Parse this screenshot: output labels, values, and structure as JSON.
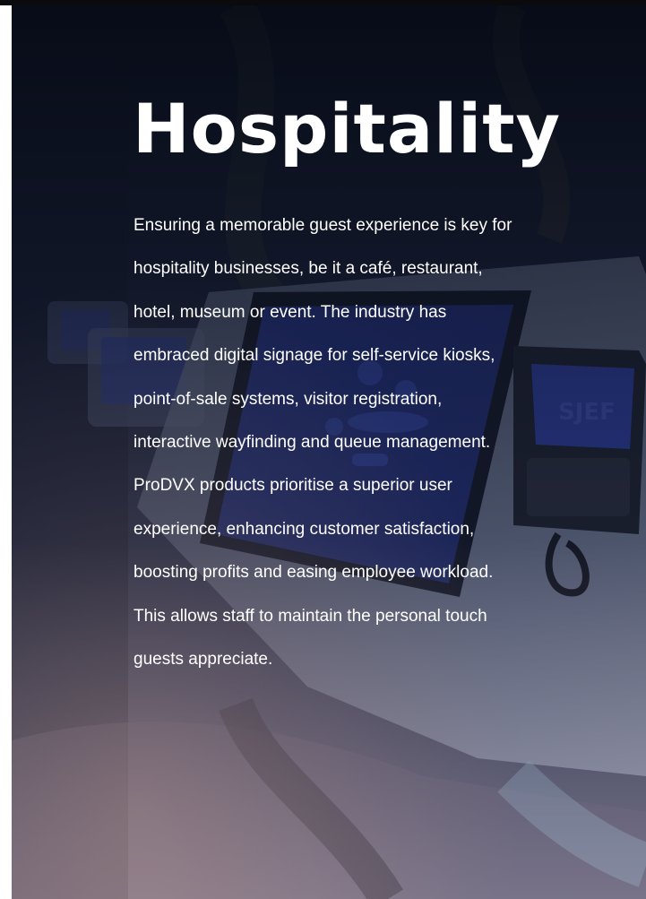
{
  "heading": "Hospitality",
  "body_lines": [
    "Ensuring a memorable guest experience is key for",
    "hospitality businesses, be it a café, restaurant,",
    "hotel, museum or event. The industry has",
    "embraced digital signage for self-service kiosks,",
    "point-of-sale systems, visitor registration,",
    "interactive wayfinding and queue management.",
    "ProDVX products prioritise a superior user",
    "experience, enhancing customer satisfaction,",
    "boosting profits and easing employee workload.",
    "This allows staff to maintain the personal touch",
    "guests appreciate."
  ],
  "colors": {
    "text": "#ffffff",
    "background_dark": "#0b1020",
    "accent_screen": "#2f46c8"
  }
}
